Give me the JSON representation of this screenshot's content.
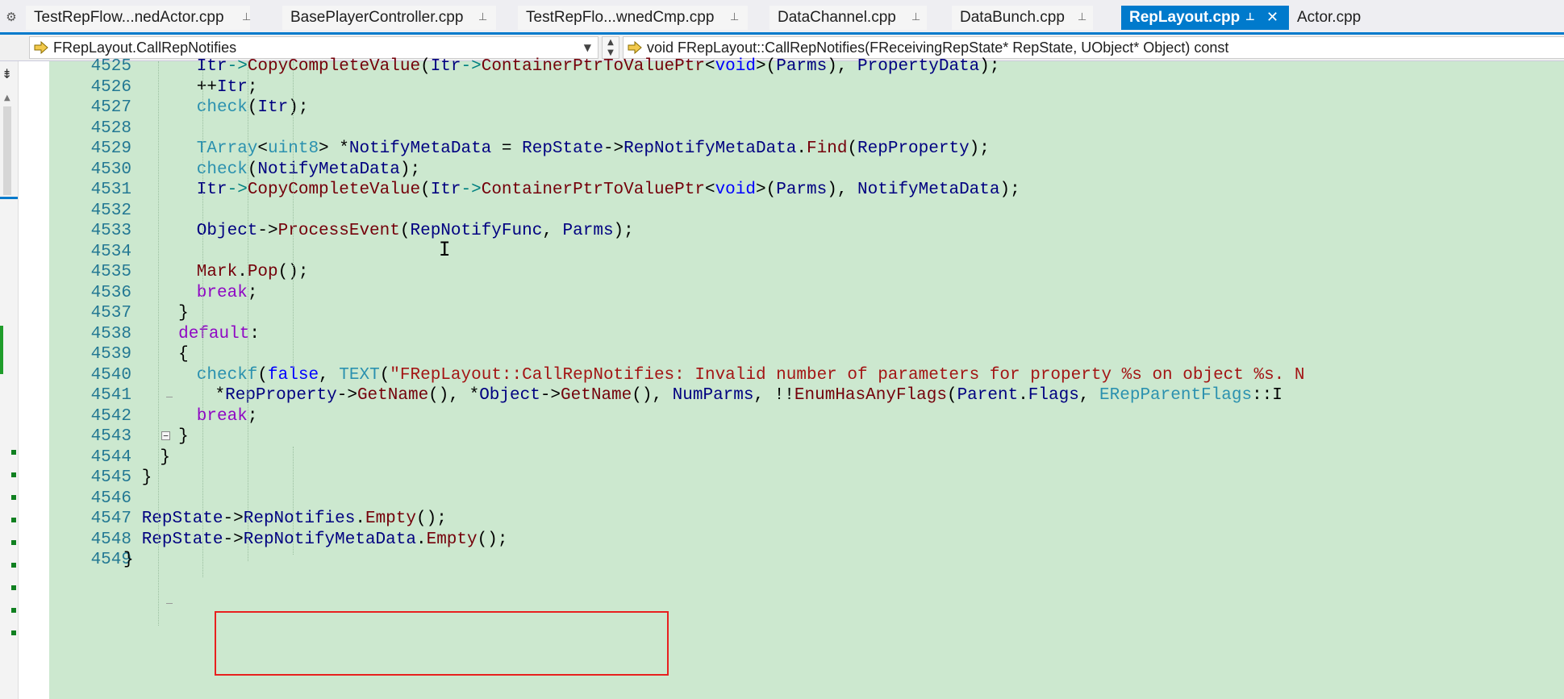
{
  "tabs": [
    {
      "label": "TestRepFlow...nedActor.cpp",
      "active": false
    },
    {
      "label": "BasePlayerController.cpp",
      "active": false
    },
    {
      "label": "TestRepFlo...wnedCmp.cpp",
      "active": false
    },
    {
      "label": "DataChannel.cpp",
      "active": false
    },
    {
      "label": "DataBunch.cpp",
      "active": false
    },
    {
      "label": "RepLayout.cpp",
      "active": true
    },
    {
      "label": "Actor.cpp",
      "active": false
    }
  ],
  "navbar": {
    "scope": "FRepLayout.CallRepNotifies",
    "member": "void FRepLayout::CallRepNotifies(FReceivingRepState* RepState, UObject* Object) const"
  },
  "editor": {
    "line_numbers": [
      "4525",
      "4526",
      "4527",
      "4528",
      "4529",
      "4530",
      "4531",
      "4532",
      "4533",
      "4534",
      "4535",
      "4536",
      "4537",
      "4538",
      "4539",
      "4540",
      "4541",
      "4542",
      "4543",
      "4544",
      "4545",
      "4546",
      "4547",
      "4548",
      "4549"
    ],
    "lines": [
      {
        "tokens": [
          [
            "v",
            "Itr"
          ],
          [
            "o",
            "->"
          ],
          [
            "f",
            "CopyCompleteValue"
          ],
          [
            "p",
            "("
          ],
          [
            "v",
            "Itr"
          ],
          [
            "o",
            "->"
          ],
          [
            "f",
            "ContainerPtrToValuePtr"
          ],
          [
            "p",
            "<"
          ],
          [
            "k",
            "void"
          ],
          [
            "p",
            ">("
          ],
          [
            "v",
            "Parms"
          ],
          [
            "p",
            "), "
          ],
          [
            "v",
            "PropertyData"
          ],
          [
            "p",
            ");"
          ]
        ]
      },
      {
        "tokens": [
          [
            "p",
            "++"
          ],
          [
            "v",
            "Itr"
          ],
          [
            "p",
            ";"
          ]
        ]
      },
      {
        "tokens": [
          [
            "t",
            "check"
          ],
          [
            "p",
            "("
          ],
          [
            "v",
            "Itr"
          ],
          [
            "p",
            ");"
          ]
        ]
      },
      {
        "tokens": []
      },
      {
        "tokens": [
          [
            "t",
            "TArray"
          ],
          [
            "p",
            "<"
          ],
          [
            "t",
            "uint8"
          ],
          [
            "p",
            "> *"
          ],
          [
            "v",
            "NotifyMetaData"
          ],
          [
            "p",
            " = "
          ],
          [
            "v",
            "RepState"
          ],
          [
            "p",
            "->"
          ],
          [
            "v",
            "RepNotifyMetaData"
          ],
          [
            "p",
            "."
          ],
          [
            "f",
            "Find"
          ],
          [
            "p",
            "("
          ],
          [
            "v",
            "RepProperty"
          ],
          [
            "p",
            ");"
          ]
        ]
      },
      {
        "tokens": [
          [
            "t",
            "check"
          ],
          [
            "p",
            "("
          ],
          [
            "v",
            "NotifyMetaData"
          ],
          [
            "p",
            ");"
          ]
        ]
      },
      {
        "tokens": [
          [
            "v",
            "Itr"
          ],
          [
            "o",
            "->"
          ],
          [
            "f",
            "CopyCompleteValue"
          ],
          [
            "p",
            "("
          ],
          [
            "v",
            "Itr"
          ],
          [
            "o",
            "->"
          ],
          [
            "f",
            "ContainerPtrToValuePtr"
          ],
          [
            "p",
            "<"
          ],
          [
            "k",
            "void"
          ],
          [
            "p",
            ">("
          ],
          [
            "v",
            "Parms"
          ],
          [
            "p",
            "), "
          ],
          [
            "v",
            "NotifyMetaData"
          ],
          [
            "p",
            ");"
          ]
        ]
      },
      {
        "tokens": []
      },
      {
        "tokens": [
          [
            "v",
            "Object"
          ],
          [
            "p",
            "->"
          ],
          [
            "f",
            "ProcessEvent"
          ],
          [
            "p",
            "("
          ],
          [
            "v",
            "RepNotifyFunc"
          ],
          [
            "p",
            ", "
          ],
          [
            "v",
            "Parms"
          ],
          [
            "p",
            ");"
          ]
        ]
      },
      {
        "tokens": []
      },
      {
        "tokens": [
          [
            "f",
            "Mark"
          ],
          [
            "p",
            "."
          ],
          [
            "f",
            "Pop"
          ],
          [
            "p",
            "();"
          ]
        ]
      },
      {
        "tokens": [
          [
            "c",
            "break"
          ],
          [
            "p",
            ";"
          ]
        ]
      },
      {
        "tokens": [
          [
            "p",
            "}"
          ]
        ]
      },
      {
        "tokens": [
          [
            "c",
            "default"
          ],
          [
            "p",
            ":"
          ]
        ]
      },
      {
        "tokens": [
          [
            "p",
            "{"
          ]
        ]
      },
      {
        "tokens": [
          [
            "t",
            "checkf"
          ],
          [
            "p",
            "("
          ],
          [
            "k",
            "false"
          ],
          [
            "p",
            ", "
          ],
          [
            "t",
            "TEXT"
          ],
          [
            "p",
            "("
          ],
          [
            "s",
            "\"FRepLayout::CallRepNotifies: Invalid number of parameters for property %s on object %s. N"
          ]
        ]
      },
      {
        "tokens": [
          [
            "p",
            "*"
          ],
          [
            "v",
            "RepProperty"
          ],
          [
            "p",
            "->"
          ],
          [
            "f",
            "GetName"
          ],
          [
            "p",
            "(), *"
          ],
          [
            "v",
            "Object"
          ],
          [
            "p",
            "->"
          ],
          [
            "f",
            "GetName"
          ],
          [
            "p",
            "(), "
          ],
          [
            "v",
            "NumParms"
          ],
          [
            "p",
            ", !!"
          ],
          [
            "f",
            "EnumHasAnyFlags"
          ],
          [
            "p",
            "("
          ],
          [
            "v",
            "Parent"
          ],
          [
            "p",
            "."
          ],
          [
            "v",
            "Flags"
          ],
          [
            "p",
            ", "
          ],
          [
            "t",
            "ERepParentFlags"
          ],
          [
            "p",
            "::I"
          ]
        ]
      },
      {
        "tokens": [
          [
            "c",
            "break"
          ],
          [
            "p",
            ";"
          ]
        ]
      },
      {
        "tokens": [
          [
            "p",
            "}"
          ]
        ]
      },
      {
        "tokens": [
          [
            "p",
            "}"
          ]
        ]
      },
      {
        "tokens": [
          [
            "p",
            "}"
          ]
        ]
      },
      {
        "tokens": []
      },
      {
        "tokens": [
          [
            "v",
            "RepState"
          ],
          [
            "p",
            "->"
          ],
          [
            "v",
            "RepNotifies"
          ],
          [
            "p",
            "."
          ],
          [
            "f",
            "Empty"
          ],
          [
            "p",
            "();"
          ]
        ]
      },
      {
        "tokens": [
          [
            "v",
            "RepState"
          ],
          [
            "p",
            "->"
          ],
          [
            "v",
            "RepNotifyMetaData"
          ],
          [
            "p",
            "."
          ],
          [
            "f",
            "Empty"
          ],
          [
            "p",
            "();"
          ]
        ]
      },
      {
        "tokens": [
          [
            "p",
            "}"
          ]
        ]
      }
    ]
  },
  "icons": {
    "settings": "gear-icon",
    "pin": "pin-icon",
    "close": "close-icon",
    "nav_scope": "navigate-arrow-icon",
    "nav_member": "navigate-arrow-icon"
  },
  "colors": {
    "accent": "#007acc",
    "code_background": "#cce8cf",
    "line_number": "#237893",
    "highlight_box": "#e8201f"
  }
}
